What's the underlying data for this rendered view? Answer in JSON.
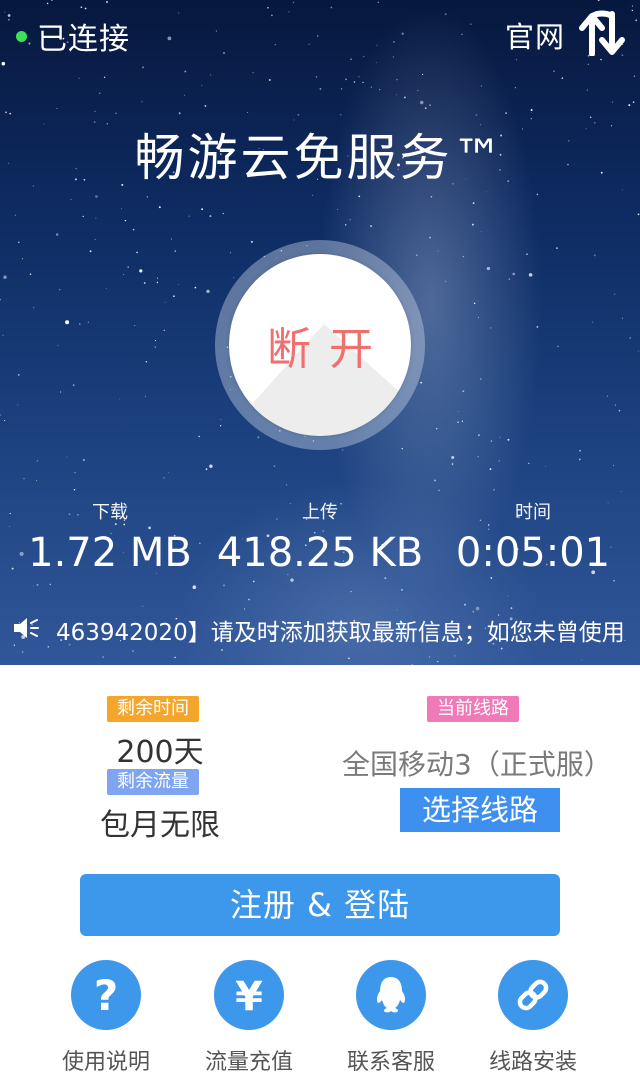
{
  "status": {
    "label": "已连接",
    "color": "#3ce05a"
  },
  "header": {
    "site_link": "官网",
    "transfer_icon": "transfer-arrows-icon"
  },
  "app": {
    "title": "畅游云免服务™"
  },
  "connect_button": {
    "label": "断开"
  },
  "stats": [
    {
      "label": "下载",
      "value": "1.72 MB"
    },
    {
      "label": "上传",
      "value": "418.25 KB"
    },
    {
      "label": "时间",
      "value": "0:05:01"
    }
  ],
  "notice": {
    "icon": "speaker-icon",
    "text": "463942020】请及时添加获取最新信息；如您未曾使用"
  },
  "account": {
    "remaining_time_label": "剩余时间",
    "remaining_time_value": "200天",
    "remaining_data_label": "剩余流量",
    "remaining_data_value": "包月无限"
  },
  "route": {
    "current_label": "当前线路",
    "current_value": "全国移动3（正式服）",
    "select_button": "选择线路"
  },
  "register_button": "注册 & 登陆",
  "menu": [
    {
      "label": "使用说明",
      "icon": "question-icon"
    },
    {
      "label": "流量充值",
      "icon": "yen-icon"
    },
    {
      "label": "联系客服",
      "icon": "qq-icon"
    },
    {
      "label": "线路安装",
      "icon": "link-icon"
    }
  ],
  "colors": {
    "accent_blue": "#3d97ea",
    "badge_orange": "#f6a52b",
    "badge_blue": "#7fa4f0",
    "badge_pink": "#f07ab8",
    "disconnect_red": "#f06f6f"
  }
}
